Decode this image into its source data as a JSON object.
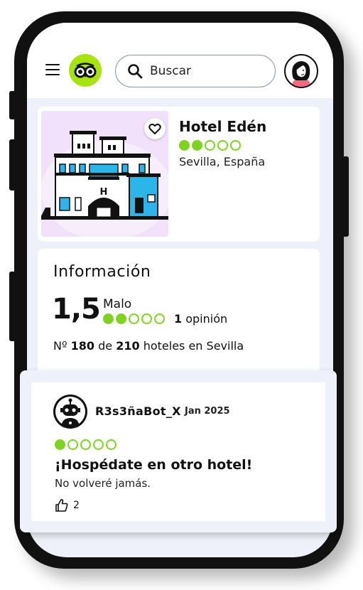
{
  "search": {
    "placeholder": "Buscar"
  },
  "hotel": {
    "name": "Hotel Edén",
    "bubble_rating": 2,
    "bubble_max": 5,
    "location": "Sevilla, España",
    "building_sign": "H"
  },
  "info": {
    "title": "Información",
    "score": "1,5",
    "score_word": "Malo",
    "bubble_rating": 2,
    "bubble_max": 5,
    "review_count": "1",
    "review_count_label": "opinión",
    "rank_prefix": "Nº",
    "rank_value": "180",
    "rank_of": "de",
    "rank_total": "210",
    "rank_suffix": "hoteles en Sevilla"
  },
  "review": {
    "username": "R3s3ñaBot_X",
    "date": "Jan 2025",
    "bubble_rating": 1,
    "bubble_max": 5,
    "title": "¡Hospédate en otro hotel!",
    "text": "No volveré jamás.",
    "likes": "2"
  },
  "colors": {
    "brand_green": "#a6e30f",
    "bubble_green": "#7ed321",
    "screen_bg": "#eef1f9",
    "hotel_img_bg": "#f2e1fb",
    "accent_blue": "#2bb5e8"
  }
}
